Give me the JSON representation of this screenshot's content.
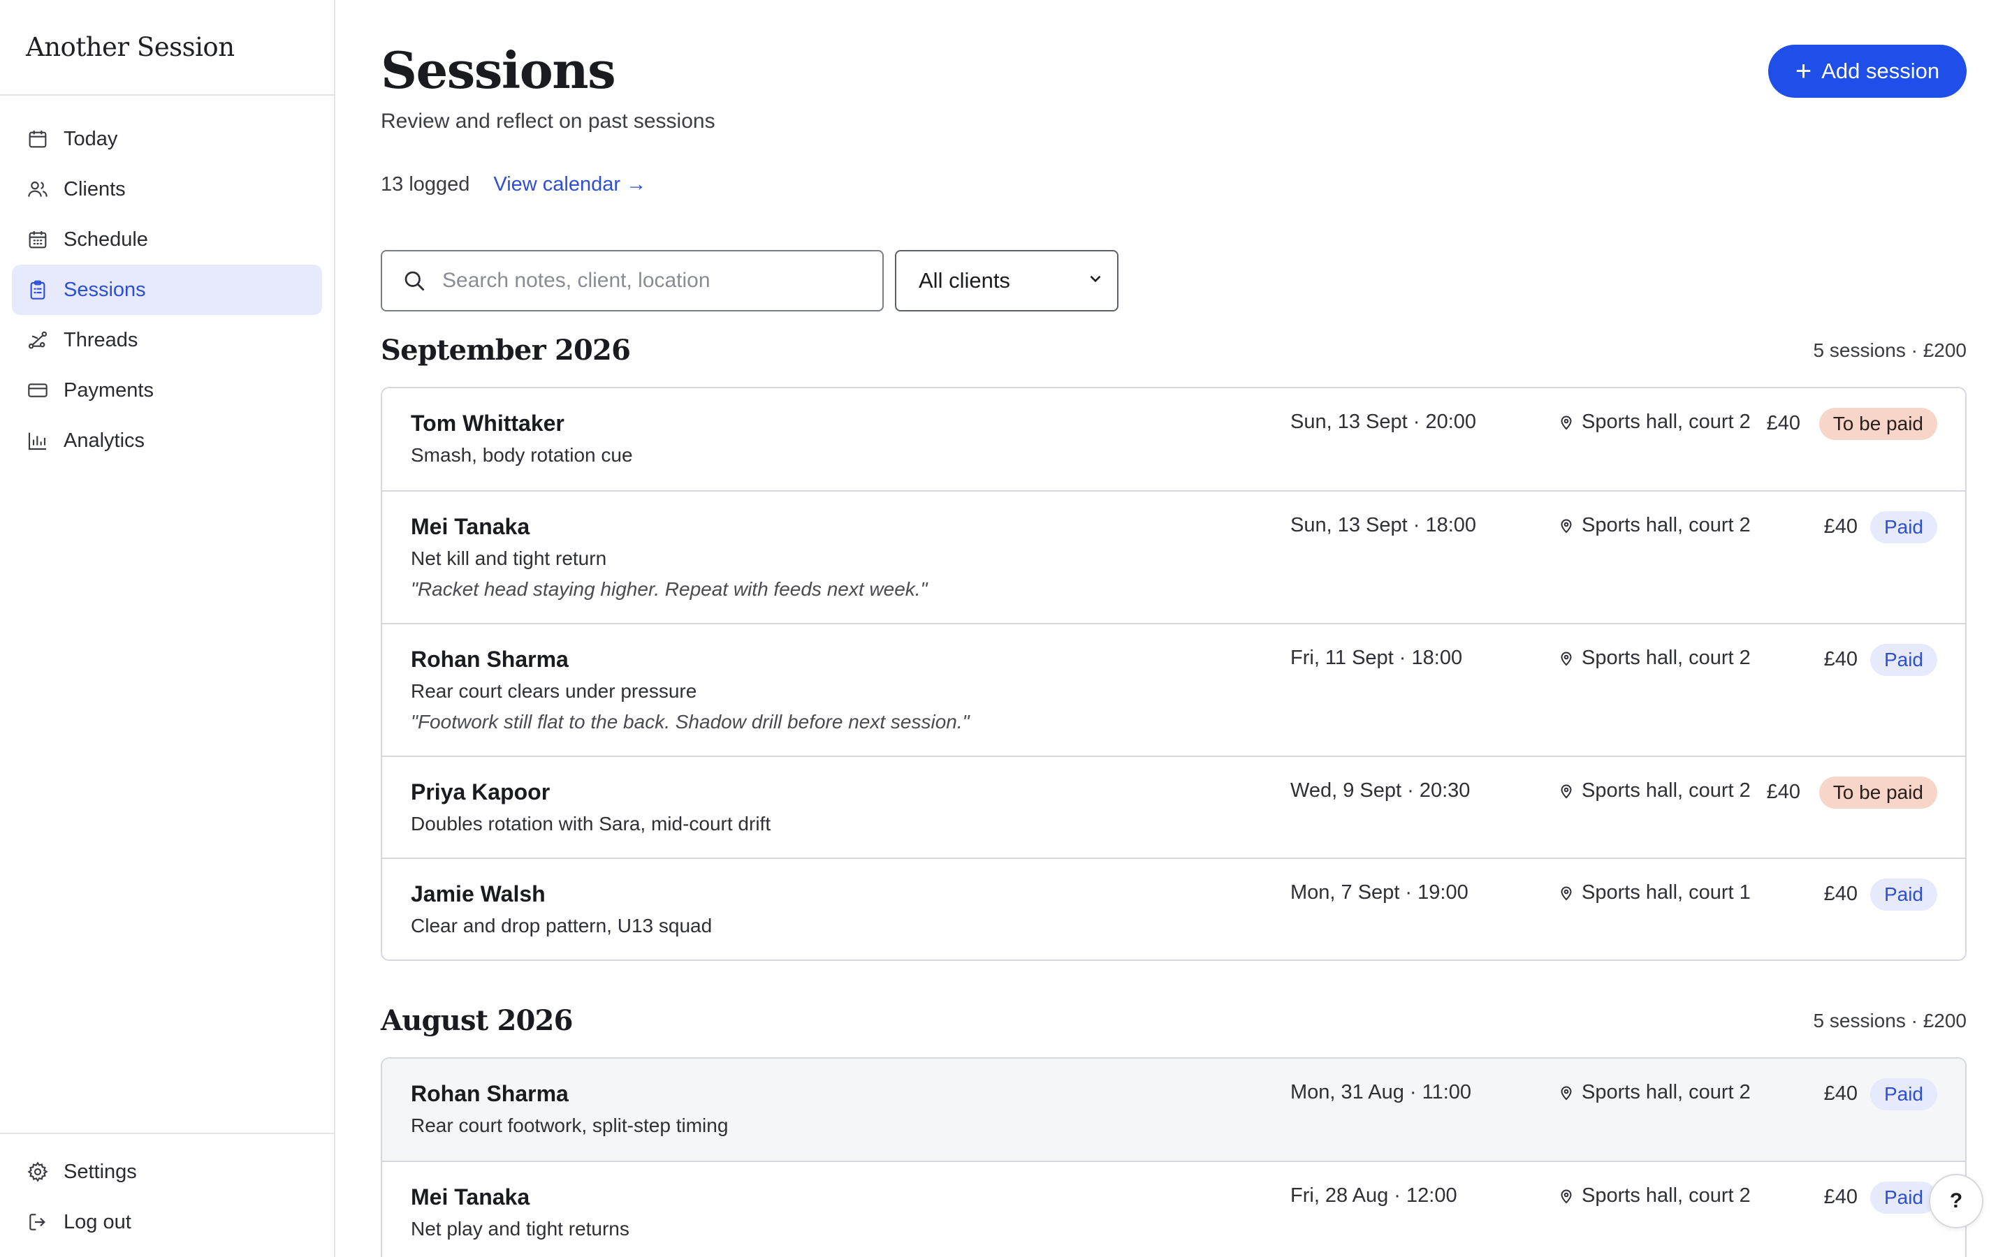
{
  "app": {
    "brand": "Another Session"
  },
  "sidebar": {
    "items": [
      {
        "label": "Today",
        "icon": "calendar-icon",
        "active": false
      },
      {
        "label": "Clients",
        "icon": "users-icon",
        "active": false
      },
      {
        "label": "Schedule",
        "icon": "calendar-grid-icon",
        "active": false
      },
      {
        "label": "Sessions",
        "icon": "clipboard-icon",
        "active": true
      },
      {
        "label": "Threads",
        "icon": "threads-icon",
        "active": false
      },
      {
        "label": "Payments",
        "icon": "credit-card-icon",
        "active": false
      },
      {
        "label": "Analytics",
        "icon": "bar-chart-icon",
        "active": false
      }
    ],
    "bottom": [
      {
        "label": "Settings",
        "icon": "gear-icon"
      },
      {
        "label": "Log out",
        "icon": "logout-icon"
      }
    ]
  },
  "header": {
    "title": "Sessions",
    "subtitle": "Review and reflect on past sessions",
    "add_label": "Add session",
    "count_label": "13 logged",
    "calendar_link": "View calendar →"
  },
  "filters": {
    "search_placeholder": "Search notes, client, location",
    "client_select": "All clients"
  },
  "months": [
    {
      "title": "September 2026",
      "summary": "5 sessions · £200",
      "sessions": [
        {
          "name": "Tom Whittaker",
          "focus": "Smash, body rotation cue",
          "note": "",
          "when": "Sun, 13 Sept · 20:00",
          "where": "Sports hall, court 2",
          "amount": "£40",
          "status": "To be paid"
        },
        {
          "name": "Mei Tanaka",
          "focus": "Net kill and tight return",
          "note": "\"Racket head staying higher. Repeat with feeds next week.\"",
          "when": "Sun, 13 Sept · 18:00",
          "where": "Sports hall, court 2",
          "amount": "£40",
          "status": "Paid"
        },
        {
          "name": "Rohan Sharma",
          "focus": "Rear court clears under pressure",
          "note": "\"Footwork still flat to the back. Shadow drill before next session.\"",
          "when": "Fri, 11 Sept · 18:00",
          "where": "Sports hall, court 2",
          "amount": "£40",
          "status": "Paid"
        },
        {
          "name": "Priya Kapoor",
          "focus": "Doubles rotation with Sara, mid-court drift",
          "note": "",
          "when": "Wed, 9 Sept · 20:30",
          "where": "Sports hall, court 2",
          "amount": "£40",
          "status": "To be paid"
        },
        {
          "name": "Jamie Walsh",
          "focus": "Clear and drop pattern, U13 squad",
          "note": "",
          "when": "Mon, 7 Sept · 19:00",
          "where": "Sports hall, court 1",
          "amount": "£40",
          "status": "Paid"
        }
      ]
    },
    {
      "title": "August 2026",
      "summary": "5 sessions · £200",
      "sessions": [
        {
          "name": "Rohan Sharma",
          "focus": "Rear court footwork, split-step timing",
          "note": "",
          "when": "Mon, 31 Aug · 11:00",
          "where": "Sports hall, court 2",
          "amount": "£40",
          "status": "Paid"
        },
        {
          "name": "Mei Tanaka",
          "focus": "Net play and tight returns",
          "note": "",
          "when": "Fri, 28 Aug · 12:00",
          "where": "Sports hall, court 2",
          "amount": "£40",
          "status": "Paid"
        }
      ]
    }
  ],
  "help_label": "?",
  "colors": {
    "accent": "#1f4fe8",
    "paid_bg": "#e6eafc",
    "due_bg": "#f7d6c9"
  }
}
